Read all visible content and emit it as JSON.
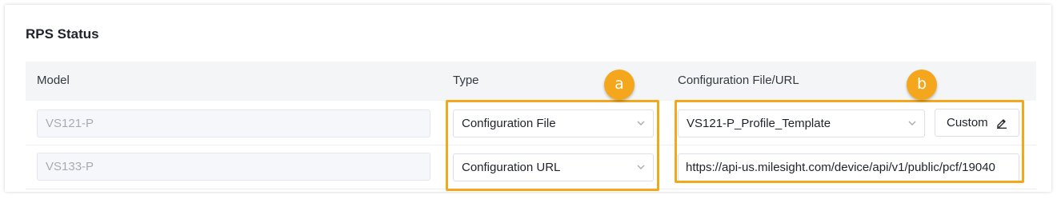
{
  "section": {
    "title": "RPS Status"
  },
  "table": {
    "columns": [
      "Model",
      "Type",
      "Configuration File/URL"
    ],
    "rows": [
      {
        "model": "VS121-P",
        "type": "Configuration File",
        "config_value": "VS121-P_Profile_Template",
        "action_label": "Custom"
      },
      {
        "model": "VS133-P",
        "type": "Configuration URL",
        "config_value": "https://api-us.milesight.com/device/api/v1/public/pcf/19040"
      }
    ]
  },
  "annotations": {
    "markers": [
      "a",
      "b"
    ],
    "color": "#f4a71d"
  },
  "icons": {
    "select": "chevron-down-icon",
    "edit": "pencil-icon"
  }
}
